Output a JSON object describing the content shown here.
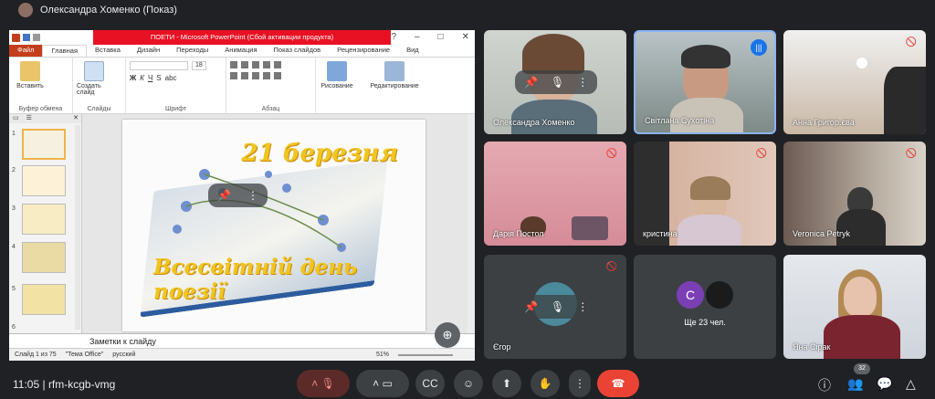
{
  "header": {
    "presenter": "Олександра Хоменко (Показ)"
  },
  "ppt": {
    "title": "ПОЕТИ  -  Microsoft PowerPoint (Сбой активации продукта)",
    "tabs": [
      "Файл",
      "Главная",
      "Вставка",
      "Дизайн",
      "Переходы",
      "Анимация",
      "Показ слайдов",
      "Рецензирование",
      "Вид"
    ],
    "ribbon": {
      "paste": "Вставить",
      "create_slide": "Создать слайд",
      "drawing": "Рисование",
      "editing": "Редактирование",
      "font_size": "18",
      "groups": [
        "Буфер обмена",
        "Слайды",
        "Шрифт",
        "Абзац"
      ]
    },
    "thumb_numbers": [
      "1",
      "2",
      "3",
      "4",
      "5",
      "6"
    ],
    "slide": {
      "line1": "21 березня",
      "line2": "Всесвітній день поезії"
    },
    "notes": "Заметки к слайду",
    "status": {
      "slide": "Слайд 1 из 75",
      "theme": "\"Тема Office\"",
      "lang": "русский",
      "zoom": "51%"
    }
  },
  "tiles": [
    {
      "name": "Олександра Хоменко"
    },
    {
      "name": "Світлана Сухотіна"
    },
    {
      "name": "Анна Григор.єва"
    },
    {
      "name": "Дарія Постол"
    },
    {
      "name": "кристина"
    },
    {
      "name": "Veronica Petryk"
    },
    {
      "name": "Єгор"
    },
    {
      "name": "Ще 23 чел.",
      "avatar_letter": "C"
    },
    {
      "name": "Яна Сірак"
    }
  ],
  "bottom": {
    "time": "11:05",
    "meeting_code": "rfm-kcgb-vmg",
    "participants_count": "32"
  },
  "colors": {
    "background": "#202124",
    "end_call": "#ea4335",
    "mic_off": "#f28b82",
    "speaking": "#1a73e8"
  }
}
